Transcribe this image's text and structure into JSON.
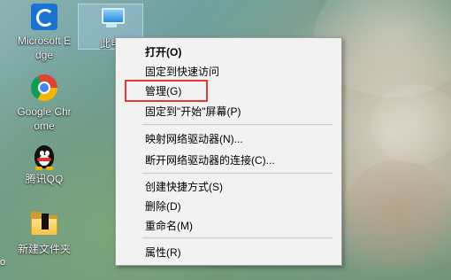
{
  "desktop": {
    "icons": [
      {
        "label": "Microsoft Edge",
        "icon": "edge-icon"
      },
      {
        "label": "此电",
        "icon": "this-pc-icon"
      },
      {
        "label": "Google Chrome",
        "icon": "chrome-icon"
      },
      {
        "label": "腾讯QQ",
        "icon": "qq-icon"
      },
      {
        "label": "新建文件夹",
        "icon": "folder-icon"
      }
    ],
    "left_edge_text": "o"
  },
  "context_menu": {
    "items": [
      {
        "label": "打开(O)",
        "bold": true
      },
      {
        "label": "固定到快速访问",
        "bold": false
      },
      {
        "label": "管理(G)",
        "bold": false,
        "highlighted": true
      },
      {
        "label": "固定到\"开始\"屏幕(P)",
        "bold": false
      },
      {
        "label": "映射网络驱动器(N)...",
        "bold": false
      },
      {
        "label": "断开网络驱动器的连接(C)...",
        "bold": false
      },
      {
        "label": "创建快捷方式(S)",
        "bold": false
      },
      {
        "label": "删除(D)",
        "bold": false
      },
      {
        "label": "重命名(M)",
        "bold": false
      },
      {
        "label": "属性(R)",
        "bold": false
      }
    ],
    "highlight_color": "#e53935"
  }
}
